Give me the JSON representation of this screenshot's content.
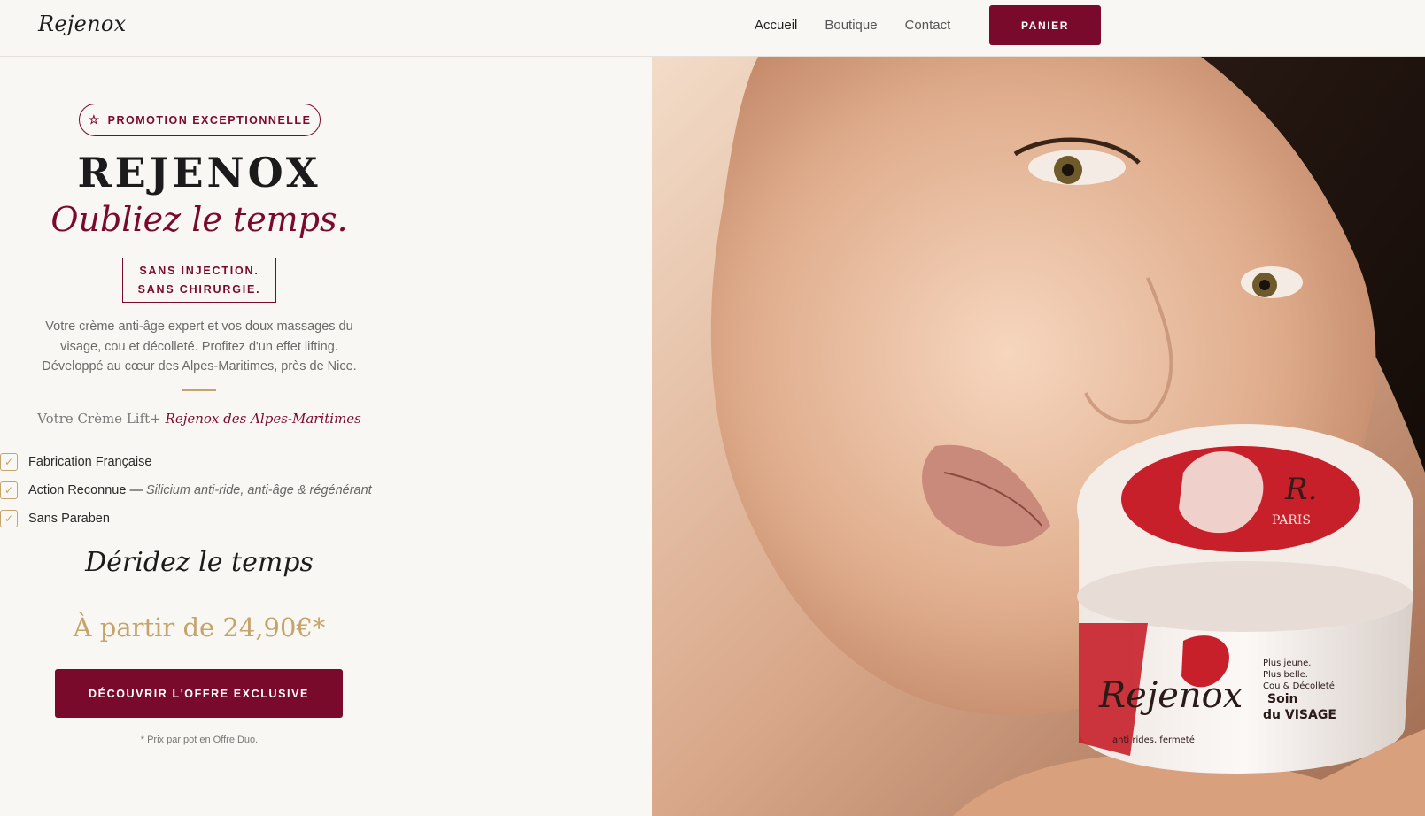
{
  "header": {
    "logo": "Rejenox",
    "nav": [
      "Accueil",
      "Boutique",
      "Contact"
    ],
    "active_nav": "Accueil",
    "cart_label": "PANIER"
  },
  "hero": {
    "promo_badge": "PROMOTION EXCEPTIONNELLE",
    "brand": "REJENOX",
    "tagline": "Oubliez le temps.",
    "no_injection_line1": "SANS INJECTION.",
    "no_injection_line2": "SANS CHIRURGIE.",
    "description_line1": "Votre crème anti-âge expert et vos doux massages du",
    "description_line2": "visage, cou et décolleté. Profitez d'un effet lifting.",
    "description_line3": "Développé au cœur des Alpes-Maritimes, près de Nice.",
    "subtitle_prefix": "Votre Crème Lift+",
    "subtitle_emphasis": "Rejenox des Alpes-Maritimes",
    "features": [
      {
        "label": "Fabrication Française",
        "detail": ""
      },
      {
        "label": "Action Reconnue —",
        "detail": "Silicium anti-ride, anti-âge & régénérant"
      },
      {
        "label": "Sans Paraben",
        "detail": ""
      }
    ],
    "heading2": "Déridez le temps",
    "price": "À partir de 24,90€*",
    "cta_label": "DÉCOUVRIR L'OFFRE EXCLUSIVE",
    "footnote": "* Prix par pot en Offre Duo."
  },
  "jar": {
    "lid_brand": "R.",
    "lid_city": "PARIS",
    "label_brand": "Rejenox",
    "label_line1": "Soin",
    "label_line2": "du VISAGE",
    "label_tag1": "Plus jeune.",
    "label_tag2": "Plus belle.",
    "label_tag3": "Cou & Décolleté",
    "label_bottom": "anti rides, fermeté"
  },
  "colors": {
    "accent": "#7a0a2c",
    "gold": "#c4a46a",
    "background": "#f9f7f3"
  }
}
